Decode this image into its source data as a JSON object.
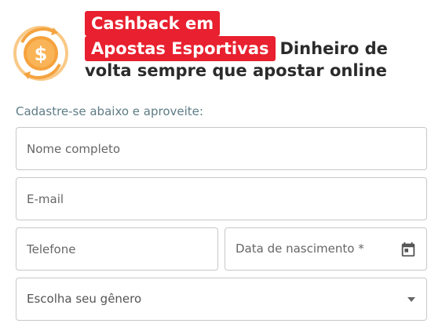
{
  "header": {
    "highlight_line1": "Cashback em",
    "highlight_line2": "Apostas Esportivas",
    "text_line2": "Dinheiro de",
    "text_line3": "volta sempre que apostar online",
    "coin_icon": "dollar-cashback-icon"
  },
  "form": {
    "subtitle": "Cadastre-se abaixo e aproveite:",
    "name_placeholder": "Nome completo",
    "email_placeholder": "E-mail",
    "phone_placeholder": "Telefone",
    "birthdate_label": "Data de nascimento *",
    "gender_label": "Escolha seu gênero"
  },
  "colors": {
    "accent_red": "#e8202f",
    "coin_orange": "#f4a340",
    "subtitle_teal": "#5e7c86"
  }
}
